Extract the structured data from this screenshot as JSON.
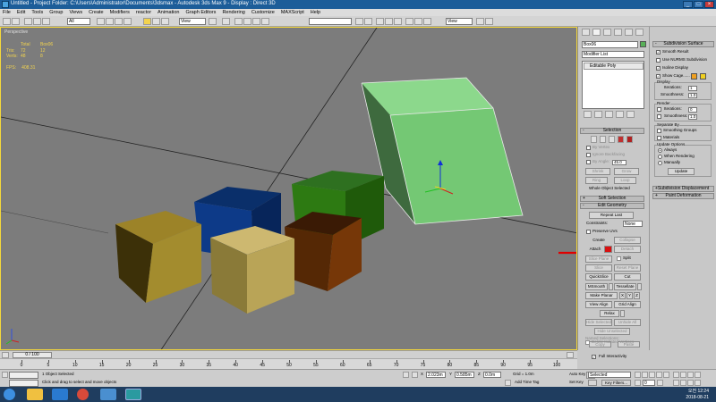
{
  "window": {
    "title": "Untitled    - Project Folder: C:\\Users\\Administrator\\Documents\\3dsmax    - Autodesk 3ds Max 9    - Display : Direct 3D"
  },
  "menu": [
    "File",
    "Edit",
    "Tools",
    "Group",
    "Views",
    "Create",
    "Modifiers",
    "reactor",
    "Animation",
    "Graph Editors",
    "Rendering",
    "Customize",
    "MAXScript",
    "Help"
  ],
  "toolbar": {
    "filter_dropdown": "All",
    "refcoord_dropdown": "View",
    "named_sel_dropdown": "",
    "view_dropdown2": "View"
  },
  "viewport": {
    "label": "Perspective",
    "stats_header": [
      "",
      "Total",
      "Box06"
    ],
    "stats_rows": [
      [
        "Tris:",
        "72",
        "12"
      ],
      [
        "Verts:",
        "48",
        "8"
      ]
    ],
    "fps_label": "FPS:",
    "fps_value": "408.31"
  },
  "command_panel": {
    "object_name": "Box06",
    "object_color": "#58b058",
    "modifier_list": "Modifier List",
    "stack_item": "Editable Poly",
    "selection": {
      "header": "Selection",
      "by_vertex": "By Vertex",
      "ignore_backfacing": "Ignore Backfacing",
      "by_angle": "By Angle:",
      "by_angle_value": "45.0",
      "shrink": "Shrink",
      "grow": "Grow",
      "ring": "Ring",
      "loop": "Loop",
      "status": "Whole Object Selected"
    },
    "soft_selection": "Soft Selection",
    "edit_geometry": {
      "header": "Edit Geometry",
      "repeat_last": "Repeat Last",
      "constraints": "Constraints:",
      "constraints_value": "None",
      "preserve_uvs": "Preserve UVs",
      "create": "Create",
      "collapse": "Collapse",
      "attach": "Attach",
      "detach": "Detach",
      "slice_plane": "Slice Plane",
      "split": "Split",
      "slice": "Slice",
      "reset_plane": "Reset Plane",
      "quickslice": "QuickSlice",
      "cut": "Cut",
      "msmooth": "MSmooth",
      "tessellate": "Tessellate",
      "make_planar": "Make Planar",
      "x": "X",
      "y": "Y",
      "z": "Z",
      "view_align": "View Align",
      "grid_align": "Grid Align",
      "relax": "Relax",
      "hide_selected": "Hide Selected",
      "unhide_all": "Unhide All",
      "hide_unselected": "Hide Unselected",
      "named_selections": "Named Selections:",
      "copy": "Copy",
      "paste": "Paste",
      "delete_isolated": "Delete Isolated Vertices",
      "full_interactivity": "Full Interactivity"
    }
  },
  "right_panel": {
    "subdivision_surface": "Subdivision Surface",
    "smooth_result": "Smooth Result",
    "use_nurms": "Use NURMS Subdivision",
    "isoline_display": "Isoline Display",
    "show_cage": "Show Cage......",
    "cage_color1": "#f0a020",
    "cage_color2": "#f0d020",
    "display_group": "Display",
    "iterations": "Iterations:",
    "iterations_value": "1",
    "smoothness": "Smoothness:",
    "smoothness_value": "1.0",
    "render_group": "Render",
    "r_iterations": "Iterations:",
    "r_iterations_value": "0",
    "r_smoothness": "Smoothness:",
    "r_smoothness_value": "1.0",
    "separate_by": "Separate By",
    "smoothing_groups": "Smoothing Groups",
    "materials": "Materials",
    "update_options": "Update Options",
    "always": "Always",
    "when_rendering": "When Rendering",
    "manually": "Manually",
    "update": "Update",
    "subdivision_displacement": "Subdivision Displacement",
    "paint_deformation": "Paint Deformation"
  },
  "timeline": {
    "slider": "0 / 100",
    "ticks": [
      "0",
      "5",
      "10",
      "15",
      "20",
      "25",
      "30",
      "35",
      "40",
      "45",
      "50",
      "55",
      "60",
      "65",
      "70",
      "75",
      "80",
      "85",
      "90",
      "95",
      "100"
    ]
  },
  "status": {
    "selection": "1 Object Selected",
    "prompt": "Click and drag to select and move objects",
    "x_label": "X",
    "x_value": "2.023m",
    "y_label": "Y",
    "y_value": "0.585m",
    "z_label": "Z",
    "z_value": "0.0m",
    "grid": "Grid = 1.0m",
    "add_time_tag": "Add Time Tag",
    "auto_key": "Auto Key",
    "selected": "Selected",
    "set_key": "Set Key",
    "key_filters": "Key Filters...",
    "frame": "0"
  },
  "taskbar": {
    "clock_time": "오전 12:24",
    "clock_date": "2018-08-21"
  }
}
